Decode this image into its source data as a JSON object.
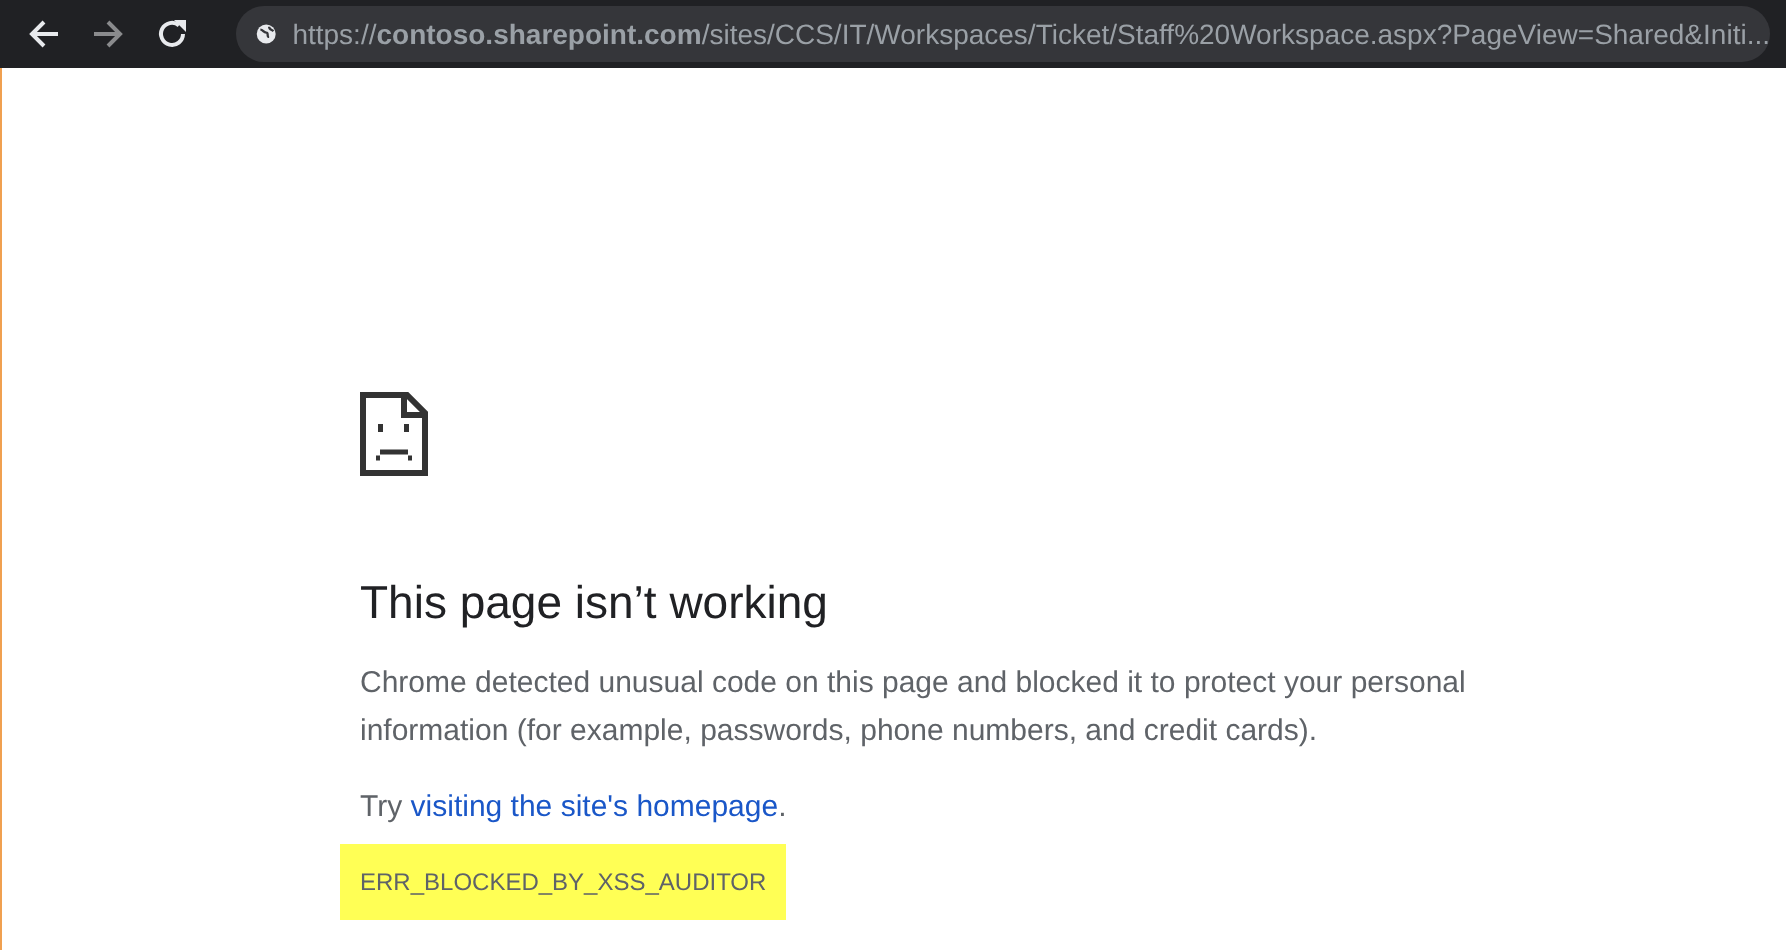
{
  "toolbar": {
    "nav_buttons": [
      {
        "kind": "back",
        "disabled": false
      },
      {
        "kind": "forward",
        "disabled": true
      },
      {
        "kind": "reload",
        "disabled": false
      }
    ],
    "address": "https://**contoso.sharepoint.com**/sites/CCS/IT/Workspaces/Ticket/Staff%20Workspace.aspx?PageView=Shared&Initi..."
  },
  "error": {
    "heading": "This page isn’t working",
    "message": "Chrome detected unusual code on this page and blocked it to protect your personal information (for example, passwords, phone numbers, and credit cards).",
    "suggestion": {
      "prefix": "Try ",
      "link": "visiting the site's homepage",
      "suffix": "."
    },
    "code": "ERR_BLOCKED_BY_XSS_AUDITOR"
  }
}
